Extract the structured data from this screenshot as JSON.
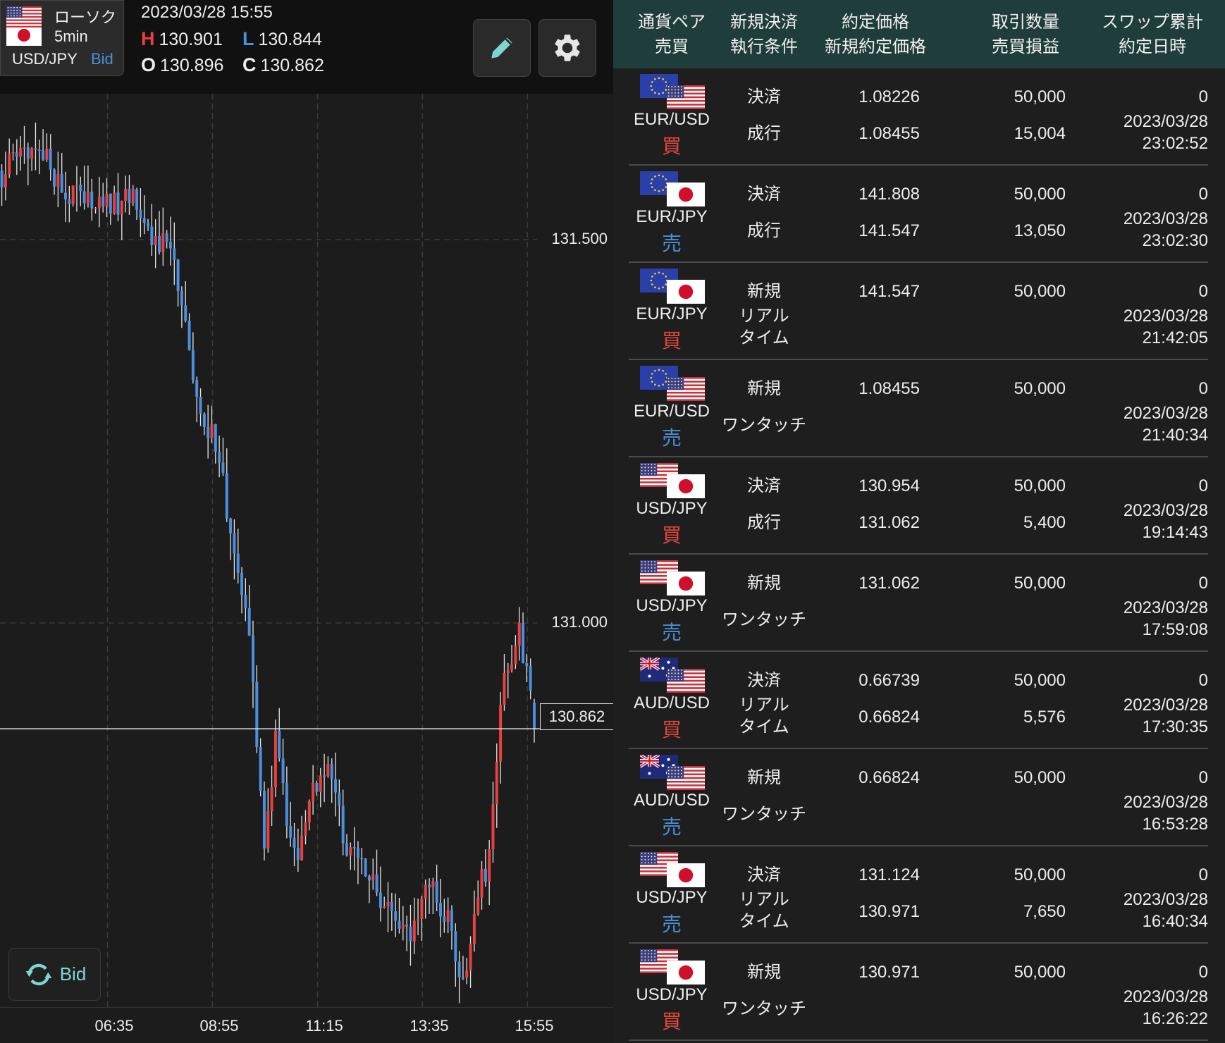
{
  "symbol_card": {
    "chart_type": "ローソク",
    "interval": "5min",
    "pair": "USD/JPY",
    "price_type": "Bid",
    "base_flag": "us",
    "quote_flag": "jp"
  },
  "header": {
    "datetime": "2023/03/28 15:55",
    "high_label": "H",
    "high": "130.901",
    "low_label": "L",
    "low": "130.844",
    "open_label": "O",
    "open": "130.896",
    "close_label": "C",
    "close": "130.862"
  },
  "toolbar": {
    "draw_icon": "pencil-icon",
    "settings_icon": "gear-icon"
  },
  "bid_toggle": {
    "label": "Bid",
    "icon": "refresh-icon"
  },
  "colors": {
    "up": "#e8413e",
    "down": "#4a8fe0",
    "buy": "#e0483c",
    "sell": "#4a8fd6",
    "header_bg": "#1f3d3a",
    "accent": "#7ed6d0"
  },
  "chart_data": {
    "type": "candlestick",
    "y_ticks": [
      "131.500",
      "131.000"
    ],
    "y_tick_values": [
      131.5,
      131.0
    ],
    "current_price": "130.862",
    "current_price_value": 130.862,
    "x_ticks": [
      "06:35",
      "08:55",
      "11:15",
      "13:35",
      "15:55"
    ],
    "x_tick_indices": [
      28,
      56,
      84,
      112,
      140
    ],
    "candle_count": 143,
    "ylim": [
      130.47,
      131.78
    ],
    "close_path": [
      [
        0,
        131.58
      ],
      [
        4,
        131.61
      ],
      [
        10,
        131.62
      ],
      [
        17,
        131.56
      ],
      [
        25,
        131.546
      ],
      [
        35,
        131.55
      ],
      [
        40,
        131.507
      ],
      [
        46,
        131.477
      ],
      [
        48,
        131.405
      ],
      [
        51,
        131.33
      ],
      [
        54,
        131.27
      ],
      [
        59,
        131.2
      ],
      [
        61,
        131.1
      ],
      [
        65,
        131.018
      ],
      [
        67,
        130.917
      ],
      [
        70,
        130.69
      ],
      [
        73,
        130.845
      ],
      [
        76,
        130.74
      ],
      [
        79,
        130.69
      ],
      [
        83,
        130.79
      ],
      [
        87,
        130.8
      ],
      [
        92,
        130.71
      ],
      [
        98,
        130.67
      ],
      [
        104,
        130.61
      ],
      [
        108,
        130.59
      ],
      [
        114,
        130.66
      ],
      [
        119,
        130.61
      ],
      [
        123,
        130.53
      ],
      [
        127,
        130.65
      ],
      [
        130,
        130.69
      ],
      [
        133,
        130.9
      ],
      [
        138,
        130.99
      ],
      [
        140,
        130.94
      ],
      [
        142,
        130.862
      ]
    ],
    "last_candle": {
      "open": 130.896,
      "high": 130.901,
      "low": 130.844,
      "close": 130.862
    }
  },
  "table": {
    "headers": [
      {
        "line1": "通貨ペア",
        "line2": "売買"
      },
      {
        "line1": "新規決済",
        "line2": "執行条件"
      },
      {
        "line1": "約定価格",
        "line2": "新規約定価格"
      },
      {
        "line1": "取引数量",
        "line2": "売買損益"
      },
      {
        "line1": "スワップ累計",
        "line2": "約定日時"
      }
    ],
    "rows": [
      {
        "pair": "EUR/USD",
        "base": "eu",
        "quote": "us",
        "side": "買",
        "side_type": "buy",
        "kind": "決済",
        "cond": [
          "成行"
        ],
        "price": "1.08226",
        "new_price": "1.08455",
        "qty": "50,000",
        "pnl": "15,004",
        "swap": "0",
        "date": "2023/03/28",
        "time": "23:02:52"
      },
      {
        "pair": "EUR/JPY",
        "base": "eu",
        "quote": "jp",
        "side": "売",
        "side_type": "sell",
        "kind": "決済",
        "cond": [
          "成行"
        ],
        "price": "141.808",
        "new_price": "141.547",
        "qty": "50,000",
        "pnl": "13,050",
        "swap": "0",
        "date": "2023/03/28",
        "time": "23:02:30"
      },
      {
        "pair": "EUR/JPY",
        "base": "eu",
        "quote": "jp",
        "side": "買",
        "side_type": "buy",
        "kind": "新規",
        "cond": [
          "リアル",
          "タイム"
        ],
        "price": "141.547",
        "new_price": "",
        "qty": "50,000",
        "pnl": "",
        "swap": "0",
        "date": "2023/03/28",
        "time": "21:42:05"
      },
      {
        "pair": "EUR/USD",
        "base": "eu",
        "quote": "us",
        "side": "売",
        "side_type": "sell",
        "kind": "新規",
        "cond": [
          "ワンタッチ"
        ],
        "price": "1.08455",
        "new_price": "",
        "qty": "50,000",
        "pnl": "",
        "swap": "0",
        "date": "2023/03/28",
        "time": "21:40:34"
      },
      {
        "pair": "USD/JPY",
        "base": "us",
        "quote": "jp",
        "side": "買",
        "side_type": "buy",
        "kind": "決済",
        "cond": [
          "成行"
        ],
        "price": "130.954",
        "new_price": "131.062",
        "qty": "50,000",
        "pnl": "5,400",
        "swap": "0",
        "date": "2023/03/28",
        "time": "19:14:43"
      },
      {
        "pair": "USD/JPY",
        "base": "us",
        "quote": "jp",
        "side": "売",
        "side_type": "sell",
        "kind": "新規",
        "cond": [
          "ワンタッチ"
        ],
        "price": "131.062",
        "new_price": "",
        "qty": "50,000",
        "pnl": "",
        "swap": "0",
        "date": "2023/03/28",
        "time": "17:59:08"
      },
      {
        "pair": "AUD/USD",
        "base": "au",
        "quote": "us",
        "side": "買",
        "side_type": "buy",
        "kind": "決済",
        "cond": [
          "リアル",
          "タイム"
        ],
        "price": "0.66739",
        "new_price": "0.66824",
        "qty": "50,000",
        "pnl": "5,576",
        "swap": "0",
        "date": "2023/03/28",
        "time": "17:30:35"
      },
      {
        "pair": "AUD/USD",
        "base": "au",
        "quote": "us",
        "side": "売",
        "side_type": "sell",
        "kind": "新規",
        "cond": [
          "ワンタッチ"
        ],
        "price": "0.66824",
        "new_price": "",
        "qty": "50,000",
        "pnl": "",
        "swap": "0",
        "date": "2023/03/28",
        "time": "16:53:28"
      },
      {
        "pair": "USD/JPY",
        "base": "us",
        "quote": "jp",
        "side": "売",
        "side_type": "sell",
        "kind": "決済",
        "cond": [
          "リアル",
          "タイム"
        ],
        "price": "131.124",
        "new_price": "130.971",
        "qty": "50,000",
        "pnl": "7,650",
        "swap": "0",
        "date": "2023/03/28",
        "time": "16:40:34"
      },
      {
        "pair": "USD/JPY",
        "base": "us",
        "quote": "jp",
        "side": "買",
        "side_type": "buy",
        "kind": "新規",
        "cond": [
          "ワンタッチ"
        ],
        "price": "130.971",
        "new_price": "",
        "qty": "50,000",
        "pnl": "",
        "swap": "0",
        "date": "2023/03/28",
        "time": "16:26:22"
      }
    ]
  }
}
